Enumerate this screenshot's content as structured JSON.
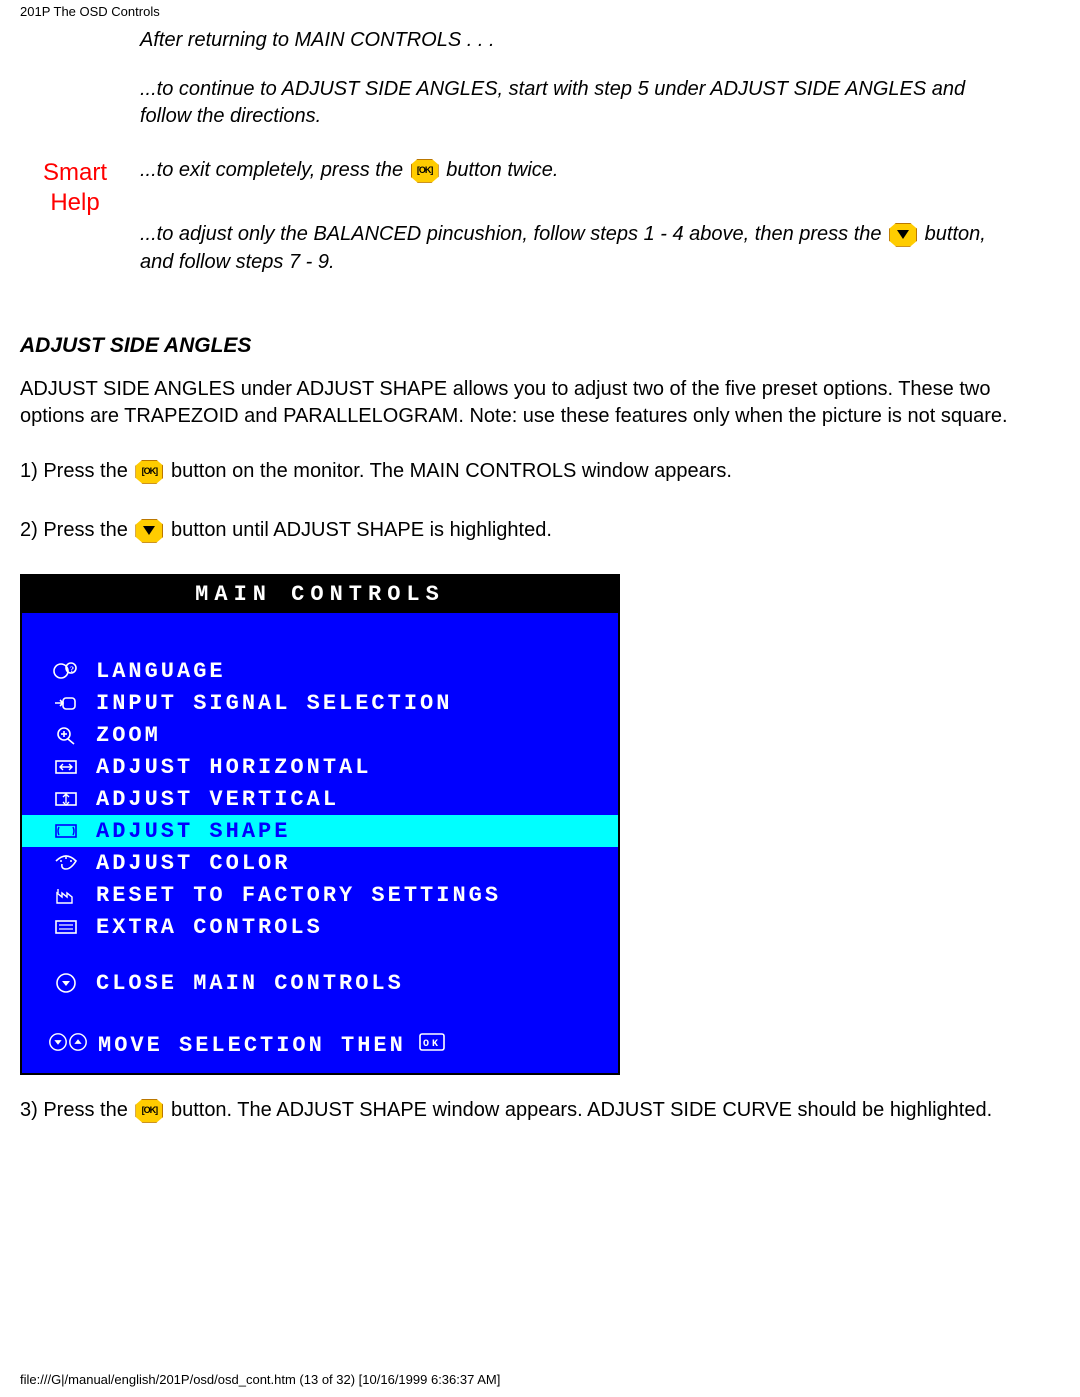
{
  "header": "201P The OSD Controls",
  "intro": {
    "line1": "After returning to MAIN CONTROLS . . .",
    "line2": "...to continue to ADJUST SIDE ANGLES, start with step 5 under ADJUST SIDE ANGLES and follow the directions."
  },
  "smart_help": {
    "label1": "Smart",
    "label2": "Help",
    "exit_prefix": "...to exit completely, press the ",
    "exit_suffix": " button twice.",
    "balanced_prefix": "...to adjust only the BALANCED pincushion, follow steps 1 - 4 above, then press the ",
    "balanced_suffix": " button, and follow steps 7 - 9."
  },
  "section_heading": "ADJUST SIDE ANGLES",
  "section_intro": "ADJUST SIDE ANGLES under ADJUST SHAPE allows you to adjust two of the five preset options. These two options are TRAPEZOID and PARALLELOGRAM. Note: use these features only when the picture is not square.",
  "step1_prefix": "1) Press the ",
  "step1_suffix": " button on the monitor. The MAIN CONTROLS window appears.",
  "step2_prefix": "2) Press the ",
  "step2_suffix": " button until ADJUST SHAPE is highlighted.",
  "osd": {
    "title": "MAIN CONTROLS",
    "items": [
      {
        "label": "LANGUAGE"
      },
      {
        "label": "INPUT SIGNAL SELECTION"
      },
      {
        "label": "ZOOM"
      },
      {
        "label": "ADJUST HORIZONTAL"
      },
      {
        "label": "ADJUST VERTICAL"
      },
      {
        "label": "ADJUST SHAPE",
        "highlight": true
      },
      {
        "label": "ADJUST COLOR"
      },
      {
        "label": "RESET TO FACTORY SETTINGS"
      },
      {
        "label": "EXTRA CONTROLS"
      }
    ],
    "close": "CLOSE MAIN CONTROLS",
    "footer": "MOVE SELECTION THEN",
    "ok_glyph": "OK"
  },
  "step3_prefix": "3) Press the ",
  "step3_suffix": " button. The ADJUST SHAPE window appears. ADJUST SIDE CURVE should be highlighted.",
  "footer_text": "file:///G|/manual/english/201P/osd/osd_cont.htm (13 of 32) [10/16/1999 6:36:37 AM]"
}
